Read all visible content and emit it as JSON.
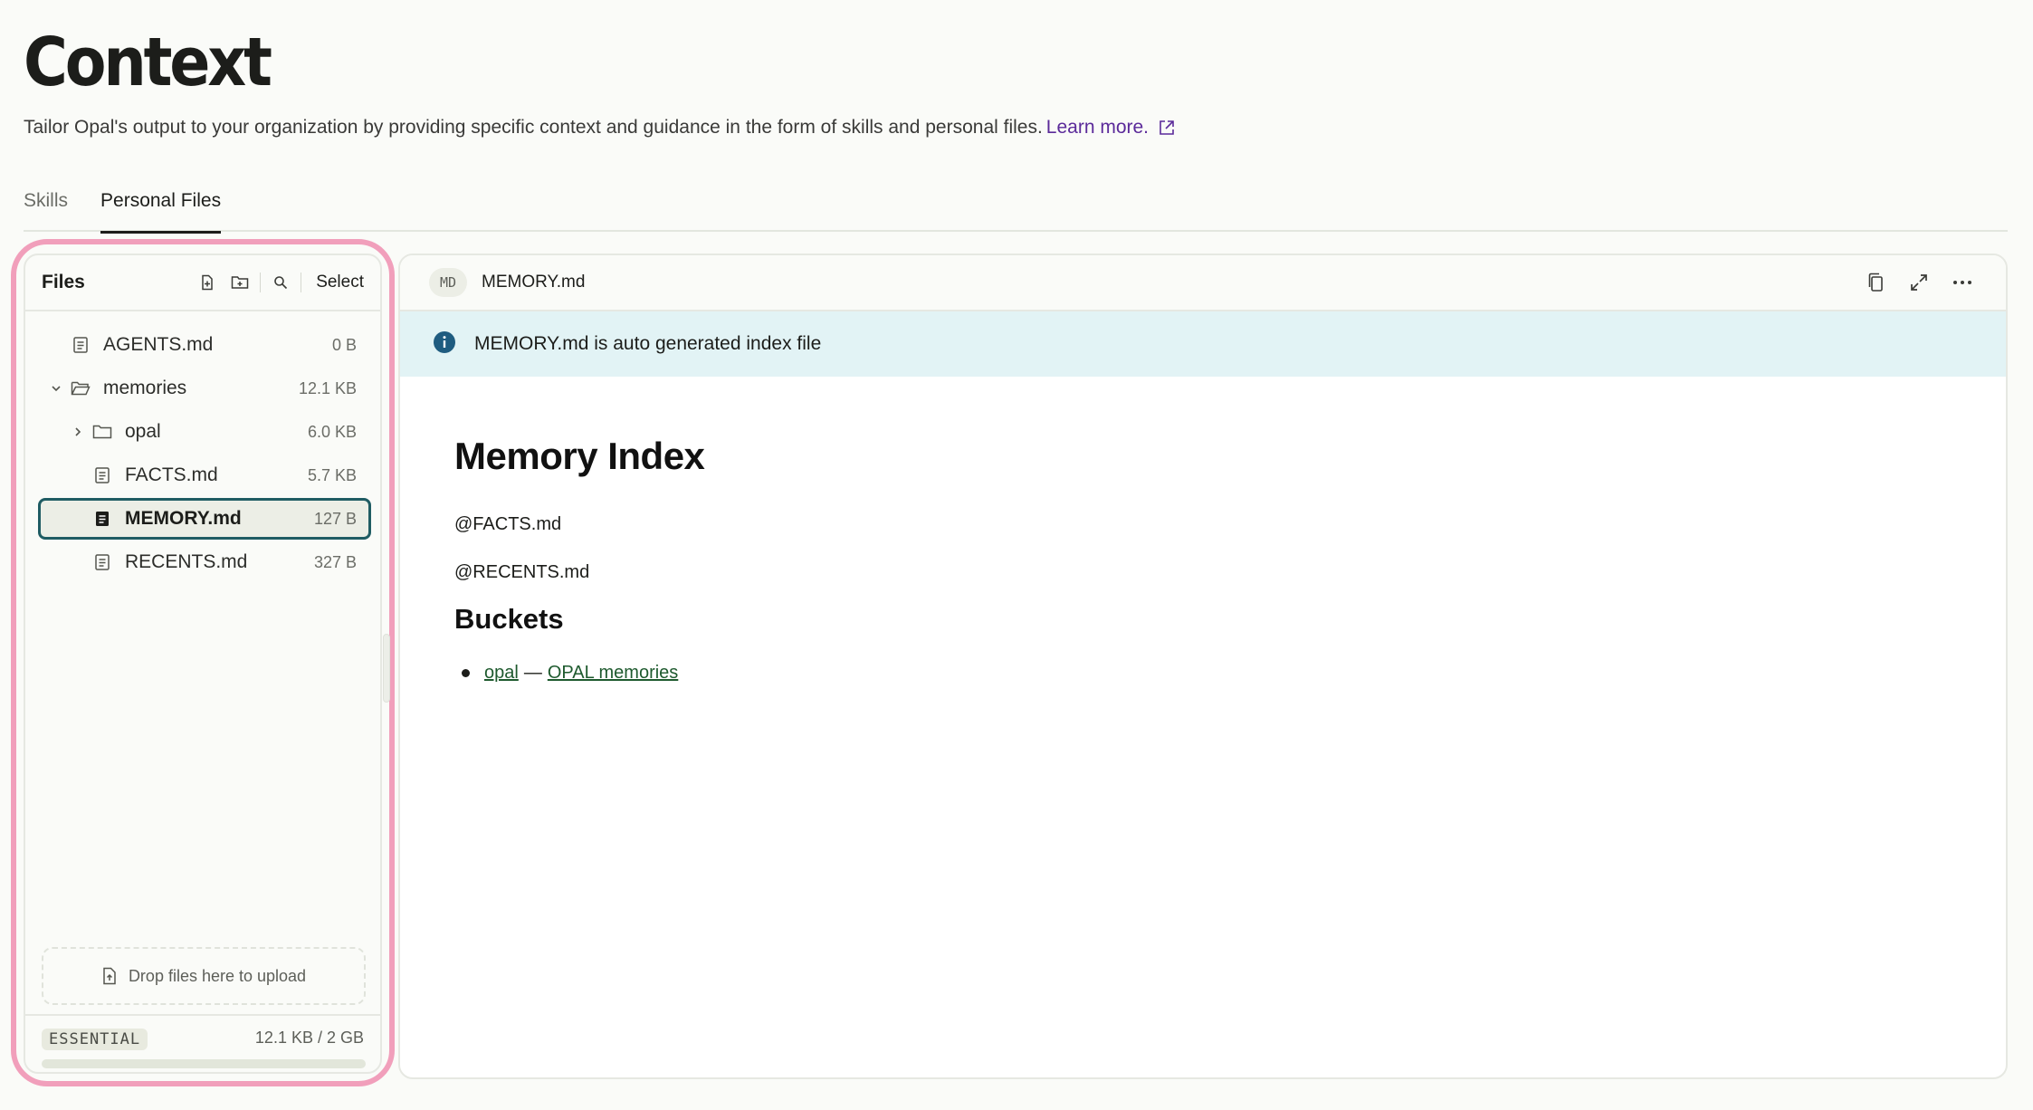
{
  "page": {
    "title": "Context",
    "subtitle": "Tailor Opal's output to your organization by providing specific context and guidance in the form of skills and personal files.",
    "learn_more": "Learn more."
  },
  "tabs": [
    {
      "label": "Skills",
      "active": false
    },
    {
      "label": "Personal Files",
      "active": true
    }
  ],
  "files_panel": {
    "title": "Files",
    "select_label": "Select",
    "tree": [
      {
        "name": "AGENTS.md",
        "size": "0 B",
        "kind": "file"
      },
      {
        "name": "memories",
        "size": "12.1 KB",
        "kind": "folder",
        "expanded": true
      },
      {
        "name": "opal",
        "size": "6.0 KB",
        "kind": "folder",
        "expanded": false
      },
      {
        "name": "FACTS.md",
        "size": "5.7 KB",
        "kind": "file"
      },
      {
        "name": "MEMORY.md",
        "size": "127 B",
        "kind": "file",
        "selected": true
      },
      {
        "name": "RECENTS.md",
        "size": "327 B",
        "kind": "file"
      }
    ],
    "dropzone": "Drop files here to upload",
    "plan": "ESSENTIAL",
    "usage": "12.1 KB / 2 GB",
    "usage_fraction": 0.0
  },
  "editor": {
    "type_badge": "MD",
    "filename": "MEMORY.md",
    "banner": "MEMORY.md is auto generated index file",
    "doc": {
      "h1": "Memory Index",
      "p1": "@FACTS.md",
      "p2": "@RECENTS.md",
      "h2": "Buckets",
      "bucket_link": "opal",
      "bucket_dash": "—",
      "bucket_desc": "OPAL memories"
    }
  },
  "colors": {
    "accent_link": "#5b2a9a",
    "selection_border": "#1f5c63",
    "highlight_ring": "#f19fbb",
    "banner_bg": "#e2f3f5",
    "info_icon": "#1f5c80",
    "doc_link": "#1e5a2e"
  },
  "icons": {
    "external_link": "external-link-icon",
    "new_file": "new-file-icon",
    "new_folder": "new-folder-icon",
    "search": "search-icon",
    "file": "file-icon",
    "folder": "folder-icon",
    "folder_open": "folder-open-icon",
    "chevron_down": "chevron-down-icon",
    "chevron_right": "chevron-right-icon",
    "upload": "upload-file-icon",
    "copy": "copy-icon",
    "expand": "expand-icon",
    "more": "more-icon",
    "info": "info-icon"
  }
}
